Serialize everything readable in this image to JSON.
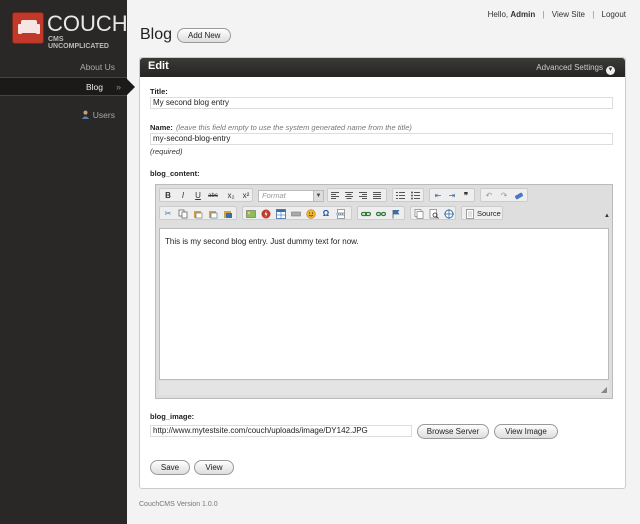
{
  "brand": {
    "name": "COUCH",
    "tagline": "CMS UNCOMPLICATED"
  },
  "sidebar": {
    "items": [
      {
        "label": "About Us"
      },
      {
        "label": "Blog",
        "arrow": "»"
      },
      {
        "label": "Users"
      }
    ]
  },
  "toplinks": {
    "hello": "Hello,",
    "user": "Admin",
    "view_site": "View Site",
    "logout": "Logout",
    "separator": "|"
  },
  "page": {
    "title": "Blog",
    "add_new": "Add New"
  },
  "panel": {
    "title": "Edit",
    "advanced": "Advanced Settings"
  },
  "form": {
    "title_label": "Title:",
    "title_value": "My second blog entry",
    "name_label": "Name:",
    "name_hint": "(leave this field empty to use the system generated name from the title)",
    "name_value": "my-second-blog-entry",
    "required": "(required)",
    "content_label": "blog_content:",
    "content_value": "This is my second blog entry. Just dummy text for now.",
    "format_placeholder": "Format",
    "source_label": "Source",
    "image_label": "blog_image:",
    "image_value": "http://www.mytestsite.com/couch/uploads/image/DY142.JPG",
    "browse_server": "Browse Server",
    "view_image": "View Image",
    "save": "Save",
    "view": "View"
  },
  "toolbar": {
    "bold": "B",
    "italic": "I",
    "underline": "U",
    "strike": "abc",
    "subscript": "x₂",
    "superscript": "x²",
    "blockquote": "❞"
  },
  "footer": {
    "version": "CouchCMS Version 1.0.0"
  },
  "colors": {
    "sidebar_bg": "#2a2826",
    "panel_header": "#2f2d2a",
    "logo_red": "#c0392b"
  }
}
